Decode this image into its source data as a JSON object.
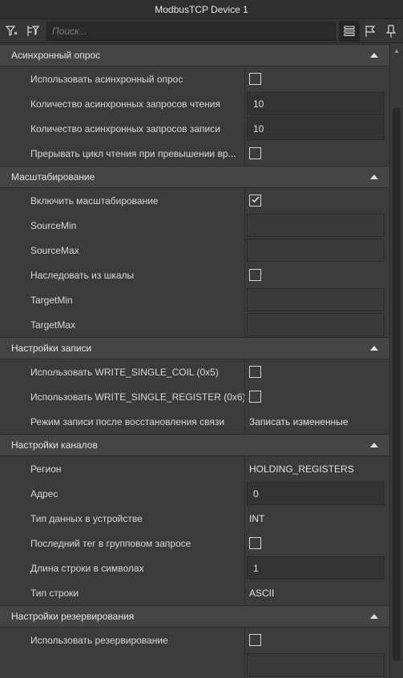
{
  "window": {
    "title": "ModbusTCP Device 1"
  },
  "toolbar": {
    "search_placeholder": "Поиск..."
  },
  "sections": [
    {
      "title": "Асинхронный опрос",
      "rows": [
        {
          "label": "Использовать асинхронный опрос",
          "type": "checkbox",
          "checked": false
        },
        {
          "label": "Количество асинхронных запросов чтения",
          "type": "field",
          "value": "10"
        },
        {
          "label": "Количество асинхронных запросов записи",
          "type": "field",
          "value": "10"
        },
        {
          "label": "Прерывать цикл чтения при превышении вр...",
          "type": "checkbox",
          "checked": false
        }
      ]
    },
    {
      "title": "Масштабирование",
      "rows": [
        {
          "label": "Включить масштабирование",
          "type": "checkbox",
          "checked": true
        },
        {
          "label": "SourceMin",
          "type": "field",
          "value": ""
        },
        {
          "label": "SourceMax",
          "type": "field",
          "value": ""
        },
        {
          "label": "Наследовать из шкалы",
          "type": "checkbox",
          "checked": false
        },
        {
          "label": "TargetMin",
          "type": "field",
          "value": ""
        },
        {
          "label": "TargetMax",
          "type": "field",
          "value": ""
        }
      ]
    },
    {
      "title": "Настройки записи",
      "rows": [
        {
          "label": "Использовать WRITE_SINGLE_COIL (0x5)",
          "type": "checkbox",
          "checked": false
        },
        {
          "label": "Использовать WRITE_SINGLE_REGISTER (0x6)",
          "type": "checkbox",
          "checked": false
        },
        {
          "label": "Режим записи после восстановления связи",
          "type": "static",
          "value": "Записать измененные"
        }
      ]
    },
    {
      "title": "Настройки каналов",
      "rows": [
        {
          "label": "Регион",
          "type": "static",
          "value": "HOLDING_REGISTERS"
        },
        {
          "label": "Адрес",
          "type": "field",
          "value": "0"
        },
        {
          "label": "Тип данных в устройстве",
          "type": "static",
          "value": "INT"
        },
        {
          "label": "Последний тег в групповом запросе",
          "type": "checkbox",
          "checked": false
        },
        {
          "label": "Длина строки в символах",
          "type": "field",
          "value": "1"
        },
        {
          "label": "Тип строки",
          "type": "static",
          "value": "ASCII"
        }
      ]
    },
    {
      "title": "Настройки резервирования",
      "rows": [
        {
          "label": "Использовать резервирование",
          "type": "checkbox",
          "checked": false
        },
        {
          "label": "",
          "type": "field",
          "value": ""
        }
      ]
    }
  ]
}
